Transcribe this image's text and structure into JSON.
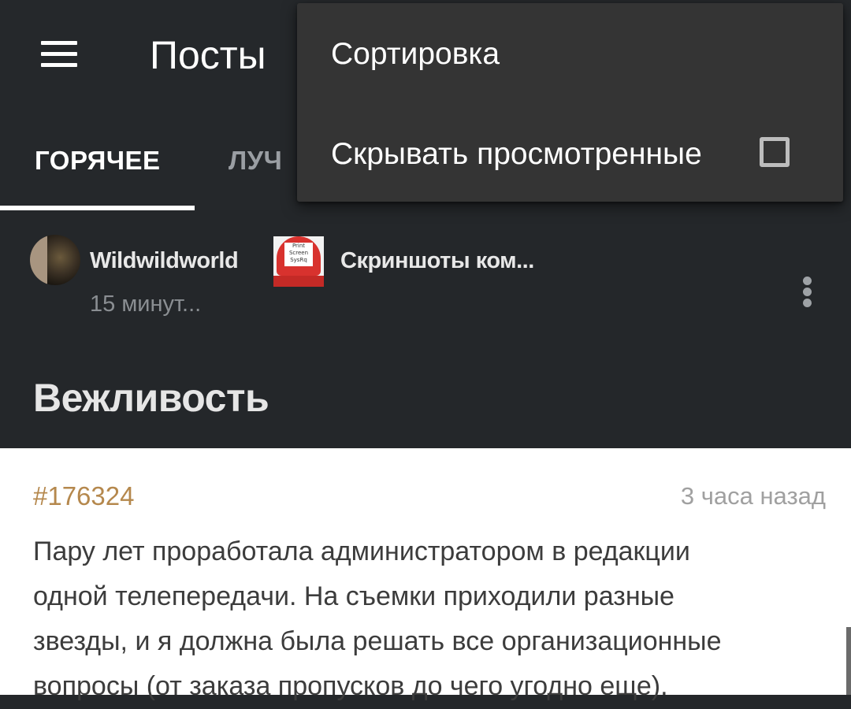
{
  "appbar": {
    "title": "Посты",
    "menu_icon": "hamburger-menu-icon"
  },
  "tabs": [
    {
      "label": "ГОРЯЧЕЕ",
      "active": true
    },
    {
      "label": "ЛУЧ",
      "active": false
    }
  ],
  "post": {
    "author": "Wildwildworld",
    "time": "15 минут...",
    "community": "Скриншоты ком...",
    "community_icon_text": "Print Screen SysRq",
    "title": "Вежливость",
    "more_icon": "more-vertical-icon"
  },
  "story": {
    "id": "#176324",
    "time": "3 часа назад",
    "lines": [
      "Пару лет проработала администратором в редакции",
      "одной телепередачи. На съемки приходили разные",
      "звезды, и я должна была решать все организационные",
      "вопросы (от заказа пропусков до чего угодно еще)."
    ]
  },
  "dropdown": {
    "items": [
      {
        "label": "Сортировка"
      },
      {
        "label": "Скрывать просмотренные",
        "checkbox": false
      }
    ]
  },
  "colors": {
    "appbar_bg": "#25282b",
    "dropdown_bg": "#343434",
    "story_id": "#b5884d"
  }
}
